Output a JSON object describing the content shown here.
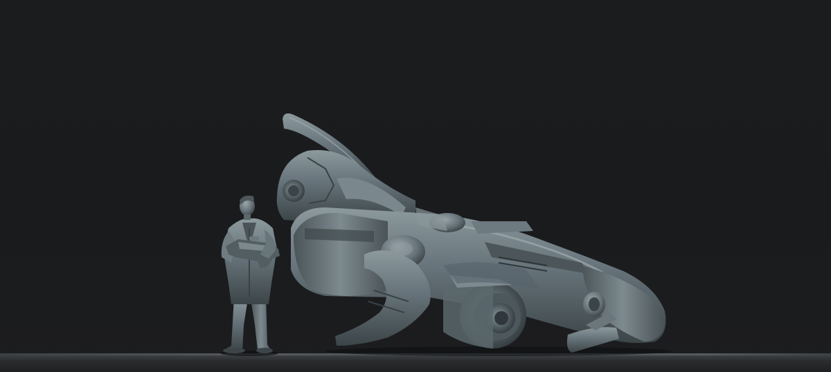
{
  "scene": {
    "subject": "3d-model-render",
    "objects": [
      "human-figure-with-rifle",
      "sci-fi-spaceship"
    ],
    "colors": {
      "background": "#1a1b1d",
      "floor": "#3a3d40",
      "model_base": "#5e6a6e",
      "model_light": "#8a979b",
      "model_dark": "#2f3639"
    }
  }
}
